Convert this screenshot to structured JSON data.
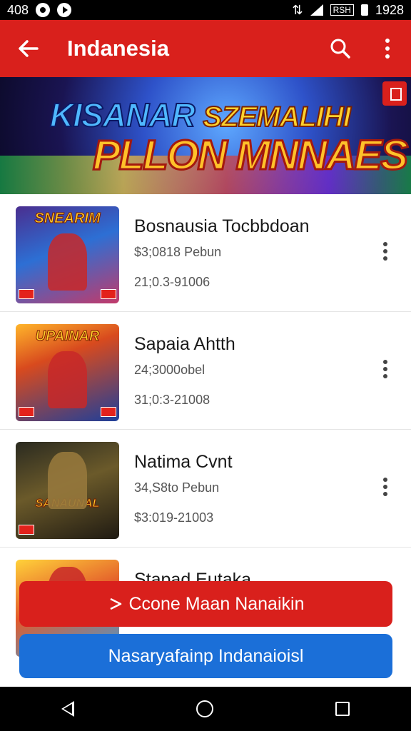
{
  "status_bar": {
    "time": "408",
    "battery_text": "1928",
    "box_text": "RSH"
  },
  "app_bar": {
    "title": "Indanesia"
  },
  "banner": {
    "line1_a": "KISANAR",
    "line1_b": "SZEMALIHI",
    "line2": "PLLON MNNAES"
  },
  "list": [
    {
      "title": "Bosnausia Tocbbdoan",
      "subtitle": "$3;0818 Pebun",
      "date": "21;0.3-91006",
      "thumb_text": "SNEARIM"
    },
    {
      "title": "Sapaia Ahtth",
      "subtitle": "24;3000obel",
      "date": "31;0:3-21008",
      "thumb_text": "UPAINAR"
    },
    {
      "title": "Natima Cvnt",
      "subtitle": "34,S8to Pebun",
      "date": "$3:019-21003",
      "thumb_text": "SANAUNAL"
    },
    {
      "title": "Stapad Eutaka"
    }
  ],
  "buttons": {
    "primary": "Ccone Maan Nanaikin",
    "secondary": "Nasaryafainp Indanaioisl"
  },
  "colors": {
    "accent_red": "#d9201c",
    "accent_blue": "#1b6fd8"
  },
  "icons": {
    "back": "arrow-left-icon",
    "search": "search-icon",
    "menu": "more-vertical-icon"
  }
}
